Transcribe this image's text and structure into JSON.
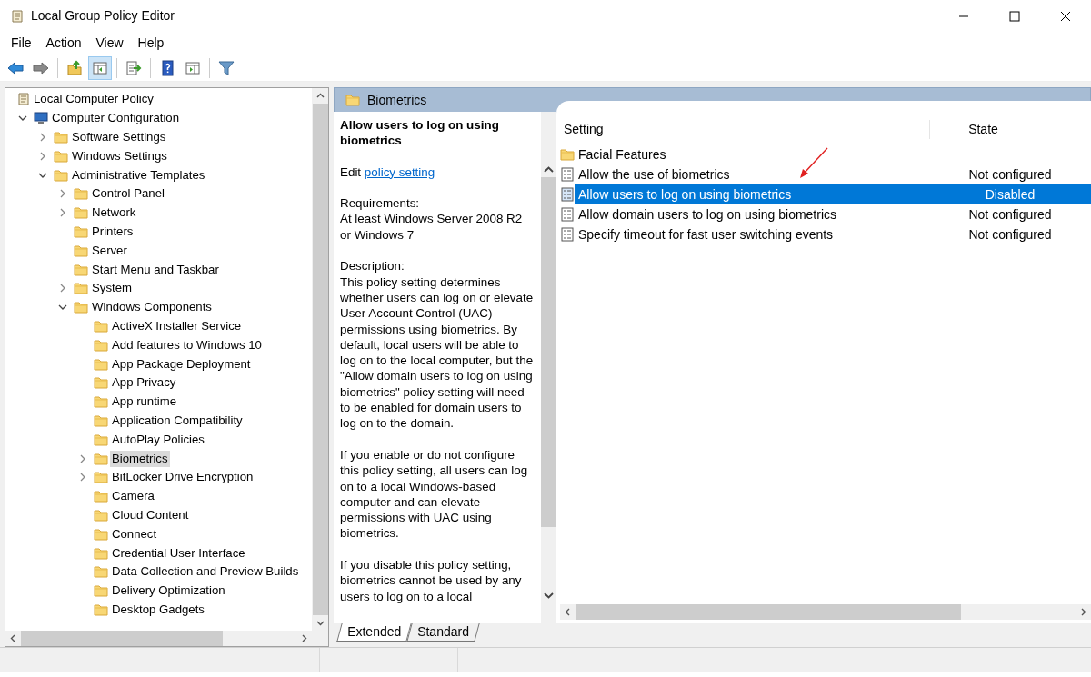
{
  "window": {
    "title": "Local Group Policy Editor"
  },
  "menu": [
    "File",
    "Action",
    "View",
    "Help"
  ],
  "toolbar": [
    {
      "kind": "back",
      "pressed": false
    },
    {
      "kind": "forward",
      "pressed": false
    },
    {
      "kind": "sep"
    },
    {
      "kind": "up",
      "pressed": false
    },
    {
      "kind": "tree",
      "pressed": true
    },
    {
      "kind": "sep"
    },
    {
      "kind": "export",
      "pressed": false
    },
    {
      "kind": "sep"
    },
    {
      "kind": "help",
      "pressed": false
    },
    {
      "kind": "pane",
      "pressed": false
    },
    {
      "kind": "sep"
    },
    {
      "kind": "filter",
      "pressed": false
    }
  ],
  "tree": [
    {
      "label": "Local Computer Policy",
      "kind": "root",
      "selected": false,
      "children": [
        {
          "label": "Computer Configuration",
          "kind": "computer",
          "expanded": true,
          "selected": false,
          "children": [
            {
              "label": "Software Settings",
              "kind": "folder",
              "expanded": false,
              "selected": false
            },
            {
              "label": "Windows Settings",
              "kind": "folder",
              "expanded": false,
              "selected": false
            },
            {
              "label": "Administrative Templates",
              "kind": "folder",
              "expanded": true,
              "selected": false,
              "children": [
                {
                  "label": "Control Panel",
                  "kind": "folder",
                  "expanded": false,
                  "selected": false
                },
                {
                  "label": "Network",
                  "kind": "folder",
                  "expanded": false,
                  "selected": false
                },
                {
                  "label": "Printers",
                  "kind": "folder",
                  "selected": false
                },
                {
                  "label": "Server",
                  "kind": "folder",
                  "selected": false
                },
                {
                  "label": "Start Menu and Taskbar",
                  "kind": "folder",
                  "selected": false
                },
                {
                  "label": "System",
                  "kind": "folder",
                  "expanded": false,
                  "selected": false
                },
                {
                  "label": "Windows Components",
                  "kind": "folder",
                  "expanded": true,
                  "selected": false,
                  "children": [
                    {
                      "label": "ActiveX Installer Service",
                      "kind": "folder",
                      "selected": false
                    },
                    {
                      "label": "Add features to Windows 10",
                      "kind": "folder",
                      "selected": false
                    },
                    {
                      "label": "App Package Deployment",
                      "kind": "folder",
                      "selected": false
                    },
                    {
                      "label": "App Privacy",
                      "kind": "folder",
                      "selected": false
                    },
                    {
                      "label": "App runtime",
                      "kind": "folder",
                      "selected": false
                    },
                    {
                      "label": "Application Compatibility",
                      "kind": "folder",
                      "selected": false
                    },
                    {
                      "label": "AutoPlay Policies",
                      "kind": "folder",
                      "selected": false
                    },
                    {
                      "label": "Biometrics",
                      "kind": "folder",
                      "expanded": false,
                      "selected": true
                    },
                    {
                      "label": "BitLocker Drive Encryption",
                      "kind": "folder",
                      "expanded": false,
                      "selected": false
                    },
                    {
                      "label": "Camera",
                      "kind": "folder",
                      "selected": false
                    },
                    {
                      "label": "Cloud Content",
                      "kind": "folder",
                      "selected": false
                    },
                    {
                      "label": "Connect",
                      "kind": "folder",
                      "selected": false
                    },
                    {
                      "label": "Credential User Interface",
                      "kind": "folder",
                      "selected": false
                    },
                    {
                      "label": "Data Collection and Preview Builds",
                      "kind": "folder",
                      "selected": false
                    },
                    {
                      "label": "Delivery Optimization",
                      "kind": "folder",
                      "selected": false
                    },
                    {
                      "label": "Desktop Gadgets",
                      "kind": "folder",
                      "selected": false
                    }
                  ]
                }
              ]
            }
          ]
        }
      ]
    }
  ],
  "details": {
    "header": "Biometrics",
    "description": {
      "title": "Allow users to log on using biometrics",
      "edit_prefix": "Edit",
      "edit_link": "policy setting",
      "paragraphs": [
        "Requirements:\nAt least Windows Server 2008 R2 or Windows 7",
        "Description:\nThis policy setting determines whether users can log on or elevate User Account Control (UAC) permissions using biometrics.  By default, local users will be able to log on to the local computer, but the \"Allow domain users to log on using biometrics\" policy setting will need to be enabled for domain users to log on to the domain.",
        "If you enable or do not configure this policy setting, all users can log on to a local Windows-based computer and can elevate permissions with UAC using biometrics.",
        "If you disable this policy setting, biometrics cannot be used by any users to log on to a local"
      ]
    },
    "columns": [
      "Setting",
      "State"
    ],
    "rows": [
      {
        "kind": "folder",
        "setting": "Facial Features",
        "selected": false
      },
      {
        "kind": "policy",
        "setting": "Allow the use of biometrics",
        "state": "Not configured",
        "selected": false
      },
      {
        "kind": "policy",
        "setting": "Allow users to log on using biometrics",
        "state": "Disabled",
        "selected": true
      },
      {
        "kind": "policy",
        "setting": "Allow domain users to log on using biometrics",
        "state": "Not configured",
        "selected": false
      },
      {
        "kind": "policy",
        "setting": "Specify timeout for fast user switching events",
        "state": "Not configured",
        "selected": false
      }
    ],
    "tabs": [
      {
        "label": "Extended",
        "selected": true
      },
      {
        "label": "Standard",
        "selected": false
      }
    ]
  }
}
